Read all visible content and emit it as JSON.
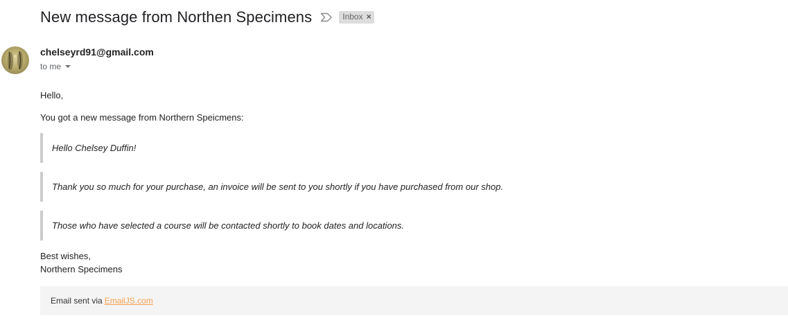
{
  "email": {
    "subject": "New message from Northen Specimens",
    "label": "Inbox",
    "label_remove": "×",
    "sender": "chelseyrd91@gmail.com",
    "recipient": "to me",
    "greeting": "Hello,",
    "intro": "You got a new message from Northern Speicmens:",
    "quotes": [
      "Hello Chelsey Duffin!",
      "Thank you so much for your purchase, an invoice will be sent to you shortly if you have purchased from our shop.",
      "Those who have selected a course will be contacted shortly to book dates and locations."
    ],
    "signoff": "Best wishes,",
    "signature": "Northern Specimens",
    "footer": {
      "text": "Email sent via",
      "link": "EmailJS.com"
    }
  },
  "icons": {
    "importance": "importance-marker-icon",
    "recipient_details": "chevron-down-icon"
  },
  "colors": {
    "label_chip_bg": "#dddddd",
    "footer_bg": "#f4f4f4",
    "footer_link": "#f4a050",
    "quote_border": "#cccccc"
  }
}
